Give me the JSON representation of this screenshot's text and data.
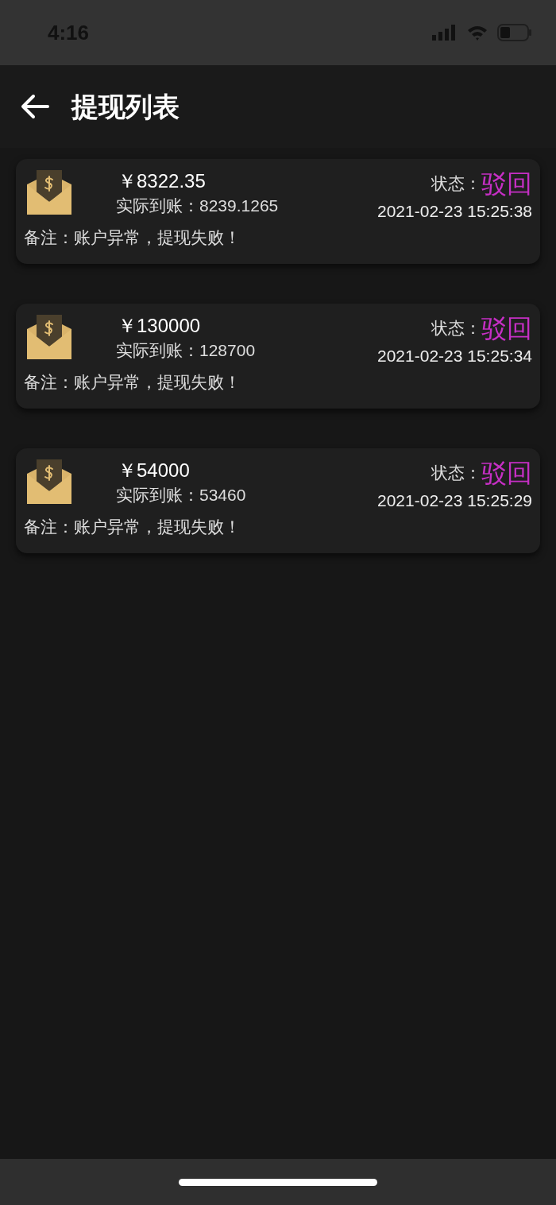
{
  "status_bar": {
    "time": "4:16"
  },
  "header": {
    "title": "提现列表"
  },
  "records": [
    {
      "amount": "￥8322.35",
      "received_label": "实际到账：",
      "received": "8239.1265",
      "status_label": "状态：",
      "status": "驳回",
      "color": "#c52fc4",
      "time": "2021-02-23 15:25:38",
      "note": "备注：账户异常，提现失败！"
    },
    {
      "amount": "￥130000",
      "received_label": "实际到账：",
      "received": "128700",
      "status_label": "状态：",
      "status": "驳回",
      "color": "#c52fc4",
      "time": "2021-02-23 15:25:34",
      "note": "备注：账户异常，提现失败！"
    },
    {
      "amount": "￥54000",
      "received_label": "实际到账：",
      "received": "53460",
      "status_label": "状态：",
      "status": "驳回",
      "color": "#c52fc4",
      "time": "2021-02-23 15:25:29",
      "note": "备注：账户异常，提现失败！"
    }
  ]
}
